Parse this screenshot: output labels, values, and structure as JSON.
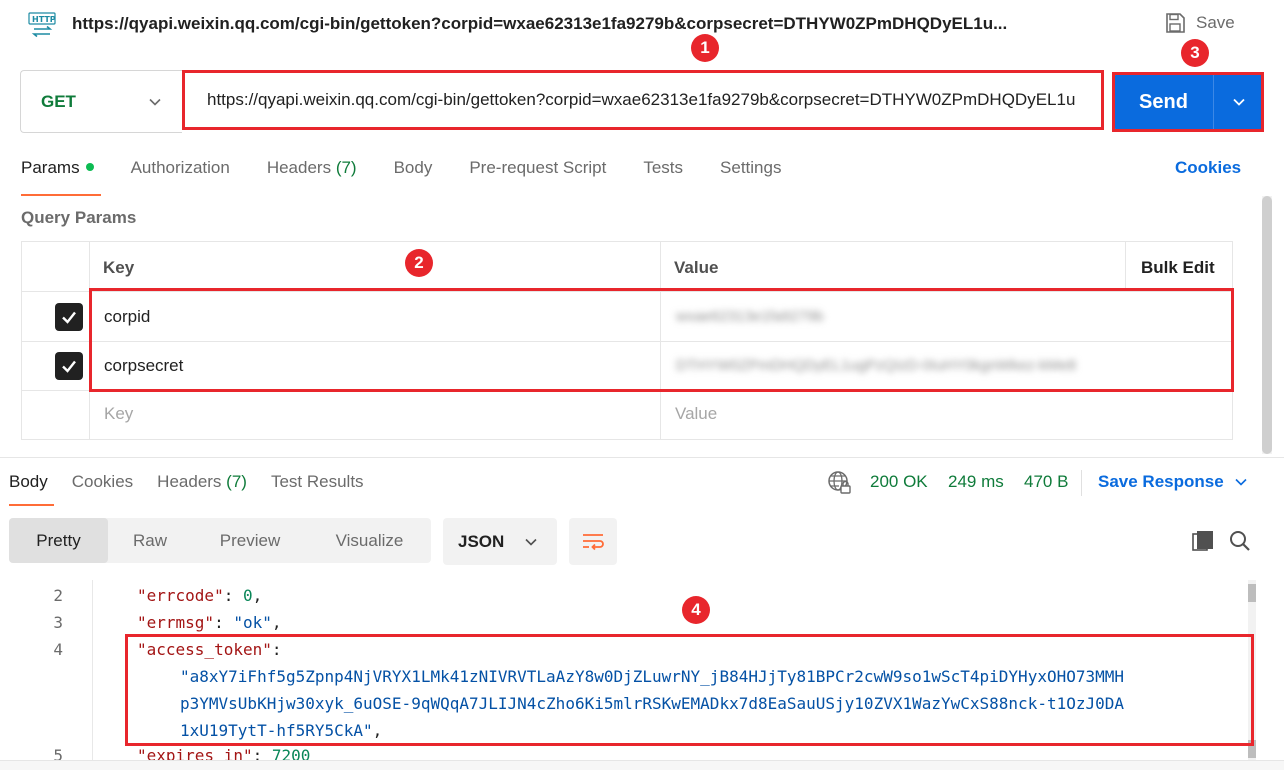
{
  "title": {
    "icon_label": "HTTP",
    "text": "https://qyapi.weixin.qq.com/cgi-bin/gettoken?corpid=wxae62313e1fa9279b&corpsecret=DTHYW0ZPmDHQDyEL1u...",
    "save_label": "Save"
  },
  "request": {
    "method": "GET",
    "url": "https://qyapi.weixin.qq.com/cgi-bin/gettoken?corpid=wxae62313e1fa9279b&corpsecret=DTHYW0ZPmDHQDyEL1u",
    "send_label": "Send"
  },
  "request_tabs": {
    "params": "Params",
    "authorization": "Authorization",
    "headers": "Headers",
    "headers_count": "(7)",
    "body": "Body",
    "prerequest": "Pre-request Script",
    "tests": "Tests",
    "settings": "Settings",
    "cookies": "Cookies"
  },
  "query_params": {
    "title": "Query Params",
    "col_key": "Key",
    "col_value": "Value",
    "bulk_edit": "Bulk Edit",
    "rows": [
      {
        "key": "corpid",
        "value": "wxae62313e1fa9279b"
      },
      {
        "key": "corpsecret",
        "value": "DTHYW0ZPmDHQDyEL1ugPzQIzD-0IuHY0kgnWkez-kMe8"
      }
    ],
    "key_placeholder": "Key",
    "value_placeholder": "Value"
  },
  "response_tabs": {
    "body": "Body",
    "cookies": "Cookies",
    "headers": "Headers",
    "headers_count": "(7)",
    "test_results": "Test Results"
  },
  "response_meta": {
    "status": "200 OK",
    "time": "249 ms",
    "size": "470 B",
    "save_response": "Save Response"
  },
  "format": {
    "pretty": "Pretty",
    "raw": "Raw",
    "preview": "Preview",
    "visualize": "Visualize",
    "language": "JSON"
  },
  "code": {
    "line_numbers": [
      "2",
      "3",
      "4",
      "5"
    ],
    "errcode_key": "\"errcode\"",
    "errcode_val": "0",
    "errmsg_key": "\"errmsg\"",
    "errmsg_val": "\"ok\"",
    "token_key": "\"access_token\"",
    "token_line1": "\"a8xY7iFhf5g5Zpnp4NjVRYX1LMk41zNIVRVTLaAzY8w0DjZLuwrNY_jB84HJjTy81BPCr2cwW9so1wScT4piDYHyxOHO73MMH",
    "token_line2": "p3YMVsUbKHjw30xyk_6uOSE-9qWQqA7JLIJN4cZho6Ki5mlrRSKwEMADkx7d8EaSauUSjy10ZVX1WazYwCxS88nck-t1OzJ0DA",
    "token_line3": "1xU19TytT-hf5RY5CkA\"",
    "expires_key": "\"expires_in\"",
    "expires_val": "7200"
  },
  "annotations": [
    "1",
    "2",
    "3",
    "4"
  ],
  "colors": {
    "accent_orange": "#ff6c37",
    "send_blue": "#0a6bde",
    "success_green": "#0f7b3a",
    "annotation_red": "#e8262c"
  }
}
